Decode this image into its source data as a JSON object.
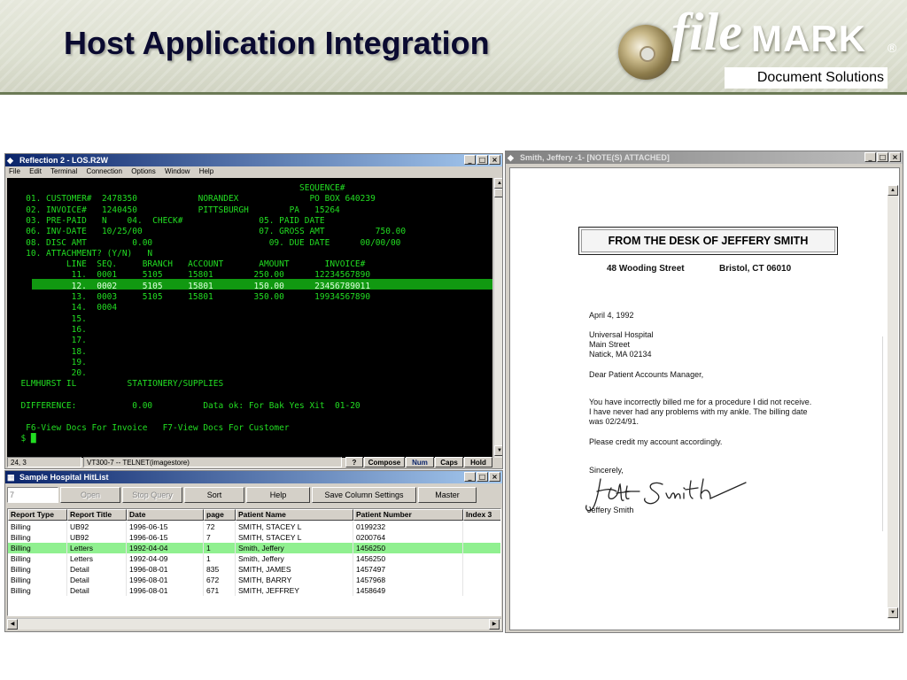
{
  "slide": {
    "title": "Host Application Integration",
    "logo": {
      "file": "file",
      "mark": "MARK",
      "registered": "®",
      "tagline": "Document Solutions"
    }
  },
  "reflection": {
    "title": "Reflection 2 - LOS.R2W",
    "menu": [
      "File",
      "Edit",
      "Terminal",
      "Connection",
      "Options",
      "Window",
      "Help"
    ],
    "window_buttons": [
      "_",
      "□",
      "×"
    ],
    "terminal_lines": [
      "                                                         SEQUENCE#",
      "   01. CUSTOMER#  2478350            NORANDEX              PO BOX 640239",
      "   02. INVOICE#   1240450            PITTSBURGH        PA   15264",
      "   03. PRE-PAID   N    04.  CHECK#               05. PAID DATE",
      "   06. INV-DATE   10/25/00                       07. GROSS AMT          750.00",
      "   08. DISC AMT         0.00                       09. DUE DATE      00/00/00",
      "   10. ATTACHMENT? (Y/N)   N",
      "           LINE  SEQ.     BRANCH   ACCOUNT       AMOUNT       INVOICE#",
      "            11.  0001     5105     15801        250.00      12234567890",
      "            12.  0002     5105     15801        150.00      23456789011",
      "            13.  0003     5105     15801        350.00      19934567890",
      "            14.  0004",
      "            15.",
      "            16.",
      "            17.",
      "            18.",
      "            19.",
      "            20.",
      "  ELMHURST IL          STATIONERY/SUPPLIES",
      "",
      "  DIFFERENCE:           0.00          Data ok: For Bak Yes Xit  01-20",
      "",
      "   F6-View Docs For Invoice   F7-View Docs For Customer",
      "  $ █"
    ],
    "status": {
      "position": "24, 3",
      "session": "VT300-7 -- TELNET(imagestore)",
      "help": "?",
      "compose": "Compose",
      "num": "Num",
      "caps": "Caps",
      "hold": "Hold"
    }
  },
  "hitlist": {
    "title": "Sample Hospital HitList",
    "field_value": "7",
    "buttons": {
      "open": "Open",
      "stop_query": "Stop Query",
      "sort": "Sort",
      "help": "Help",
      "save_columns": "Save Column Settings",
      "master": "Master"
    },
    "columns": [
      "Report Type",
      "Report Title",
      "Date",
      "page",
      "Patient Name",
      "Patient Number",
      "Index 3"
    ],
    "rows": [
      [
        "Billing",
        "UB92",
        "1996-06-15",
        "72",
        "SMITH, STACEY L",
        "0199232",
        ""
      ],
      [
        "Billing",
        "UB92",
        "1996-06-15",
        "7",
        "SMITH, STACEY L",
        "0200764",
        ""
      ],
      [
        "Billing",
        "Letters",
        "1992-04-04",
        "1",
        "Smith, Jeffery",
        "1456250",
        ""
      ],
      [
        "Billing",
        "Letters",
        "1992-04-09",
        "1",
        "Smith, Jeffery",
        "1456250",
        ""
      ],
      [
        "Billing",
        "Detail",
        "1996-08-01",
        "835",
        "SMITH, JAMES",
        "1457497",
        ""
      ],
      [
        "Billing",
        "Detail",
        "1996-08-01",
        "672",
        "SMITH, BARRY",
        "1457968",
        ""
      ],
      [
        "Billing",
        "Detail",
        "1996-08-01",
        "671",
        "SMITH, JEFFREY",
        "1458649",
        ""
      ]
    ],
    "selected_row": 2
  },
  "viewer": {
    "title": "Smith, Jeffery -1-  [NOTE(S) ATTACHED]",
    "letterhead": "FROM THE DESK OF JEFFERY SMITH",
    "address_line": "48 Wooding Street",
    "city_line": "Bristol, CT 06010",
    "date": "April 4, 1992",
    "recipient": [
      "Universal Hospital",
      "Main Street",
      "Natick, MA 02134"
    ],
    "salutation": "Dear Patient Accounts Manager,",
    "body": [
      "You have incorrectly billed me for a procedure I did not receive.",
      "I have never had any problems with my ankle.  The billing date",
      "was 02/24/91."
    ],
    "request": "Please credit my account accordingly.",
    "closing": "Sincerely,",
    "signature_name": "Jeffery Smith"
  }
}
